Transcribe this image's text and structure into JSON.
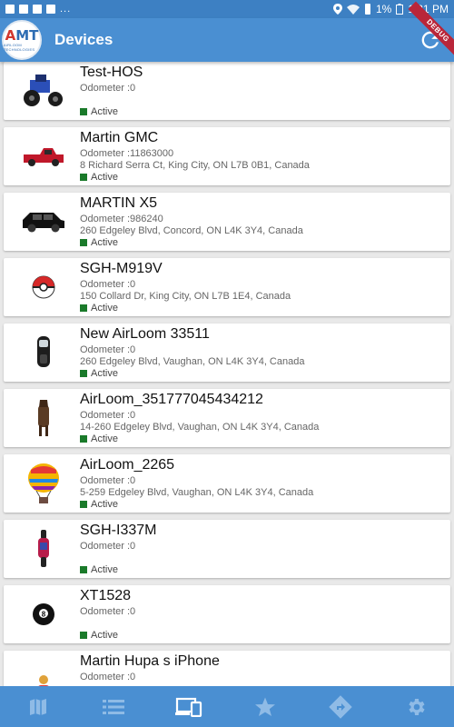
{
  "status_bar": {
    "left_icons": [
      "photo-icon",
      "mail-icon",
      "image-icon",
      "fb-icon"
    ],
    "ellipsis": "...",
    "right_icons": [
      "location-icon",
      "wifi-icon",
      "silent-icon"
    ],
    "battery": "1%",
    "time": "1:31 PM"
  },
  "app_bar": {
    "logo_text_main": "MT",
    "logo_text_prefix": "A",
    "logo_sub": "AIRLOOM TECHNOLOGIES",
    "title": "Devices",
    "debug_label": "DEBUG"
  },
  "devices": [
    {
      "name": "Test-HOS",
      "odometer": "Odometer :0",
      "address": "",
      "status": "Active",
      "icon": "tractor-icon"
    },
    {
      "name": "Martin GMC",
      "odometer": "Odometer :11863000",
      "address": "8 Richard Serra Ct, King City, ON L7B 0B1, Canada",
      "status": "Active",
      "icon": "pickup-truck-icon"
    },
    {
      "name": "MARTIN X5",
      "odometer": "Odometer :986240",
      "address": "260 Edgeley Blvd, Concord, ON L4K 3Y4, Canada",
      "status": "Active",
      "icon": "suv-icon"
    },
    {
      "name": "SGH-M919V",
      "odometer": "Odometer :0",
      "address": "150 Collard Dr, King City, ON L7B 1E4, Canada",
      "status": "Active",
      "icon": "pokeball-icon"
    },
    {
      "name": "New AirLoom 33511",
      "odometer": "Odometer :0",
      "address": "260 Edgeley Blvd, Vaughan, ON L4K 3Y4, Canada",
      "status": "Active",
      "icon": "snowmobile-icon"
    },
    {
      "name": "AirLoom_351777045434212",
      "odometer": "Odometer :0",
      "address": "14-260 Edgeley Blvd, Vaughan, ON L4K 3Y4, Canada",
      "status": "Active",
      "icon": "horse-icon"
    },
    {
      "name": "AirLoom_2265",
      "odometer": "Odometer :0",
      "address": "5-259 Edgeley Blvd, Vaughan, ON L4K 3Y4, Canada",
      "status": "Active",
      "icon": "hot-air-balloon-icon"
    },
    {
      "name": "SGH-I337M",
      "odometer": "Odometer :0",
      "address": "",
      "status": "Active",
      "icon": "motorcycle-icon"
    },
    {
      "name": "XT1528",
      "odometer": "Odometer :0",
      "address": "",
      "status": "Active",
      "icon": "eight-ball-icon"
    },
    {
      "name": "Martin Hupa s iPhone",
      "odometer": "Odometer :0",
      "address": "",
      "status": "",
      "icon": "person-icon"
    }
  ],
  "bottom_nav": [
    {
      "id": "map",
      "icon": "map-icon",
      "active": false
    },
    {
      "id": "list",
      "icon": "list-icon",
      "active": false
    },
    {
      "id": "devices",
      "icon": "devices-icon",
      "active": true
    },
    {
      "id": "favorites",
      "icon": "star-icon",
      "active": false
    },
    {
      "id": "directions",
      "icon": "directions-icon",
      "active": false
    },
    {
      "id": "settings",
      "icon": "gear-icon",
      "active": false
    }
  ],
  "colors": {
    "primary": "#4a8fd2",
    "status_bar": "#3d80c3",
    "active_status": "#1a7a2a",
    "nav_inactive": "#8fbbe6",
    "nav_active": "#ffffff",
    "debug_ribbon": "#b9263a"
  }
}
